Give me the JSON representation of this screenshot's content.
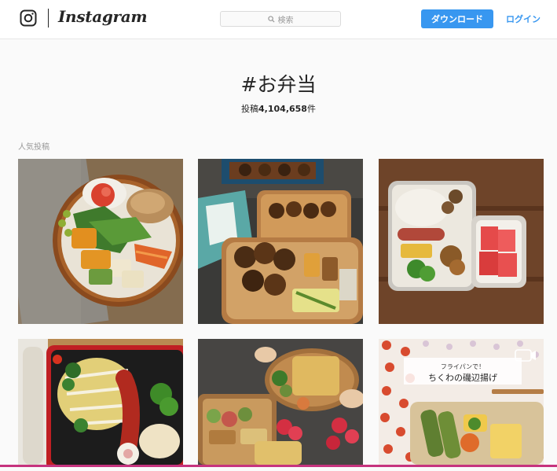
{
  "header": {
    "brand": "Instagram",
    "search_placeholder": "検索",
    "download_label": "ダウンロード",
    "login_label": "ログイン"
  },
  "hashtag": {
    "title": "#お弁当",
    "count_prefix": "投稿",
    "count_value": "4,104,658",
    "count_suffix": "件"
  },
  "section": {
    "label": "人気投稿"
  },
  "posts": [
    {
      "caption": ""
    },
    {
      "caption": ""
    },
    {
      "caption": ""
    },
    {
      "caption": ""
    },
    {
      "caption": ""
    },
    {
      "caption_line1": "フライパンで！",
      "caption_line2": "ちくわの磯辺揚げ"
    }
  ],
  "colors": {
    "accent": "#3897f0",
    "bottom_bar": "#c6337e"
  }
}
